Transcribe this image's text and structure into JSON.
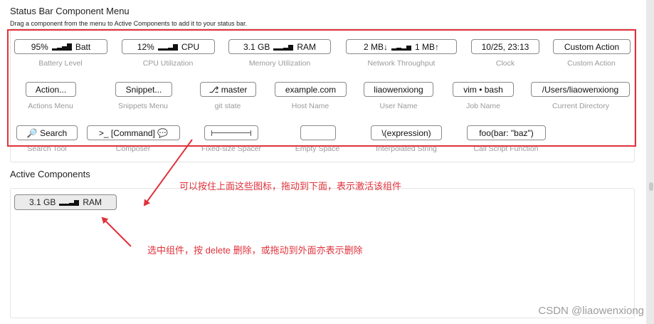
{
  "menu": {
    "title": "Status Bar Component Menu",
    "subtitle": "Drag a component from the menu to Active Components to add it to your status bar.",
    "row1": [
      {
        "label_pre": "95%",
        "label_post": "Batt",
        "caption": "Battery Level"
      },
      {
        "label_pre": "12%",
        "label_post": "CPU",
        "caption": "CPU Utilization"
      },
      {
        "label_pre": "3.1 GB",
        "label_post": "RAM",
        "caption": "Memory Utilization"
      },
      {
        "label_pre": "2 MB↓",
        "label_post": "1 MB↑",
        "caption": "Network Throughput"
      },
      {
        "label": "10/25, 23:13",
        "caption": "Clock"
      },
      {
        "label": "Custom Action",
        "caption": "Custom Action"
      }
    ],
    "row2": [
      {
        "label": "Action...",
        "caption": "Actions Menu"
      },
      {
        "label": "Snippet...",
        "caption": "Snippets Menu"
      },
      {
        "label": "⎇ master",
        "caption": "git state"
      },
      {
        "label": "example.com",
        "caption": "Host Name"
      },
      {
        "label": "liaowenxiong",
        "caption": "User Name"
      },
      {
        "label": "vim • bash",
        "caption": "Job Name"
      },
      {
        "label": "/Users/liaowenxiong",
        "caption": "Current Directory"
      }
    ],
    "row3": [
      {
        "label": "🔎 Search",
        "caption": "Search Tool"
      },
      {
        "label": ">_ [Command] 💬",
        "caption": "Composer"
      },
      {
        "label": "",
        "caption": "Fixed-size Spacer"
      },
      {
        "label": "",
        "caption": "Empty Space"
      },
      {
        "label": "\\(expression)",
        "caption": "Interpolated String"
      },
      {
        "label": "foo(bar: \"baz\")",
        "caption": "Call Script Function"
      }
    ]
  },
  "active": {
    "title": "Active Components",
    "items": [
      {
        "label_pre": "3.1 GB",
        "label_post": "RAM"
      }
    ]
  },
  "annotations": {
    "drag_note": "可以按住上面这些图标，拖动到下面，表示激活该组件",
    "delete_note": "选中组件，按 delete 删除，或拖动到外面亦表示删除"
  },
  "watermark": "CSDN @liaowenxiong",
  "colors": {
    "accent_red": "#e0323c",
    "caption_gray": "#9a9a9a"
  }
}
